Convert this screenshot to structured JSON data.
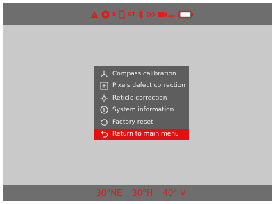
{
  "status": {
    "icons": [
      "warning-icon",
      "display-mode-icon",
      "document-icon",
      "bluetooth-icon",
      "eye-icon",
      "video-record-icon",
      "battery-icon"
    ],
    "display_mode_text": "B",
    "document_text": "GT",
    "record_sub_text": "AUT"
  },
  "menu": {
    "items": [
      {
        "label": "Compass calibration",
        "icon": "compass-calibration-icon",
        "selected": false
      },
      {
        "label": "Pixels defect correction",
        "icon": "pixel-defect-icon",
        "selected": false
      },
      {
        "label": "Reticle correction",
        "icon": "reticle-icon",
        "selected": false
      },
      {
        "label": "System information",
        "icon": "info-icon",
        "selected": false
      },
      {
        "label": "Factory reset",
        "icon": "reset-icon",
        "selected": false
      },
      {
        "label": "Return to main menu",
        "icon": "return-icon",
        "selected": true
      }
    ]
  },
  "readouts": {
    "compass": "30°NE",
    "horizontal": "30°H",
    "vertical": "40° V"
  },
  "colors": {
    "accent": "#e21010",
    "bar_background": "#6e6e6e",
    "menu_background": "#5e5e5e",
    "screen_background": "#c9c9c9"
  }
}
